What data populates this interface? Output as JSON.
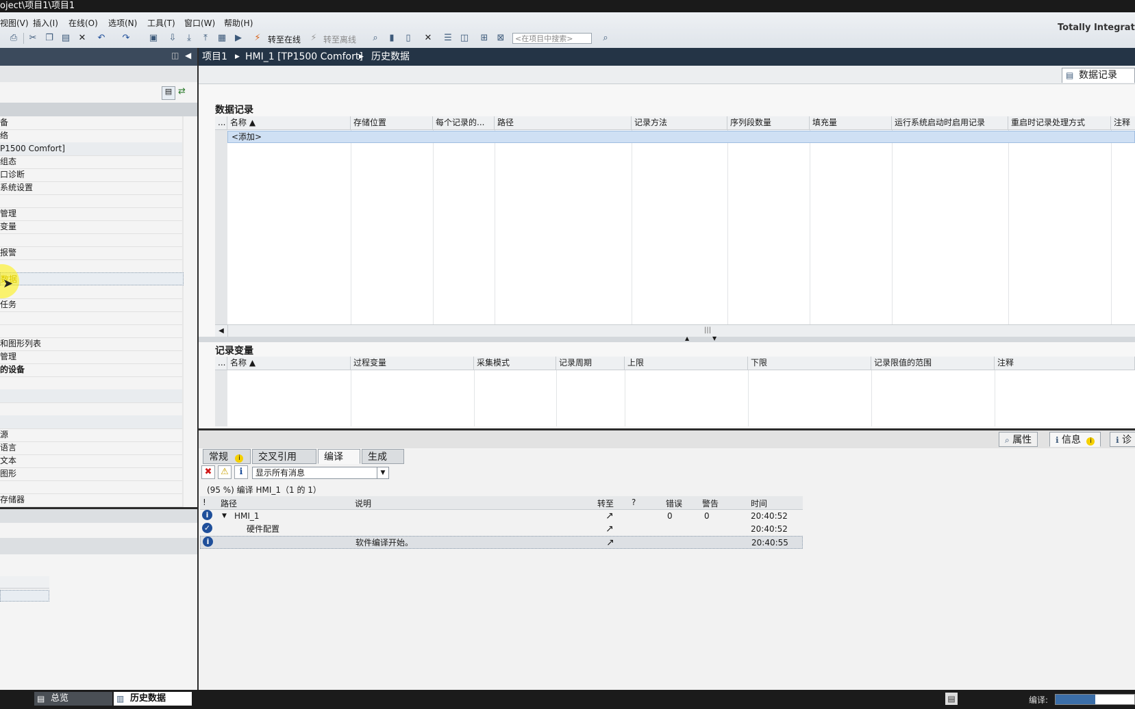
{
  "title": "oject\\项目1\\项目1",
  "menu": [
    "视图(V)",
    "插入(I)",
    "在线(O)",
    "选项(N)",
    "工具(T)",
    "窗口(W)",
    "帮助(H)"
  ],
  "toolbar": {
    "go_online": "转至在线",
    "go_offline": "转至离线",
    "search_placeholder": "<在项目中搜索>"
  },
  "brand": "Totally Integrated",
  "left_tree": [
    "备",
    "络",
    "P1500 Comfort]",
    "组态",
    "口诊断",
    "系统设置",
    "",
    "管理",
    "变量",
    "",
    "报警",
    "",
    "数据",
    "",
    "任务",
    "",
    "",
    "和图形列表",
    "管理",
    "的设备",
    "",
    "",
    "",
    "",
    "源",
    "语言",
    "文本",
    "图形",
    "",
    "存储器"
  ],
  "breadcrumb": [
    "项目1",
    "HMI_1 [TP1500 Comfort]",
    "历史数据"
  ],
  "editor_tab": "数据记录",
  "data_log": {
    "title": "数据记录",
    "columns": [
      "...",
      "名称 ▲",
      "存储位置",
      "每个记录的...",
      "路径",
      "记录方法",
      "序列段数量",
      "填充量",
      "运行系统启动时启用记录",
      "重启时记录处理方式",
      "注释"
    ],
    "add_row": "<添加>"
  },
  "log_tags": {
    "title": "记录变量",
    "columns": [
      "...",
      "名称 ▲",
      "过程变量",
      "采集模式",
      "记录周期",
      "上限",
      "下限",
      "记录限值的范围",
      "注释"
    ]
  },
  "inspector_tabs": [
    "属性",
    "信息",
    "诊"
  ],
  "info_tabs": [
    "常规",
    "交叉引用",
    "编译",
    "生成"
  ],
  "filter": "显示所有消息",
  "compile_status": "(95 %) 编译 HMI_1（1 的 1）",
  "message_columns": [
    "!",
    "路径",
    "说明",
    "转至",
    "?",
    "错误",
    "警告",
    "时间"
  ],
  "messages": [
    {
      "type": "info",
      "path": "HMI_1",
      "desc": "",
      "errors": "0",
      "warnings": "0",
      "time": "20:40:52"
    },
    {
      "type": "ok",
      "path": "硬件配置",
      "desc": "",
      "errors": "",
      "warnings": "",
      "time": "20:40:52"
    },
    {
      "type": "info",
      "path": "",
      "desc": "软件编译开始。",
      "errors": "",
      "warnings": "",
      "time": "20:40:55"
    }
  ],
  "taskbar": {
    "overview": "总览",
    "history": "历史数据",
    "compile_label": "编译:",
    "compile_progress": 0.5
  }
}
